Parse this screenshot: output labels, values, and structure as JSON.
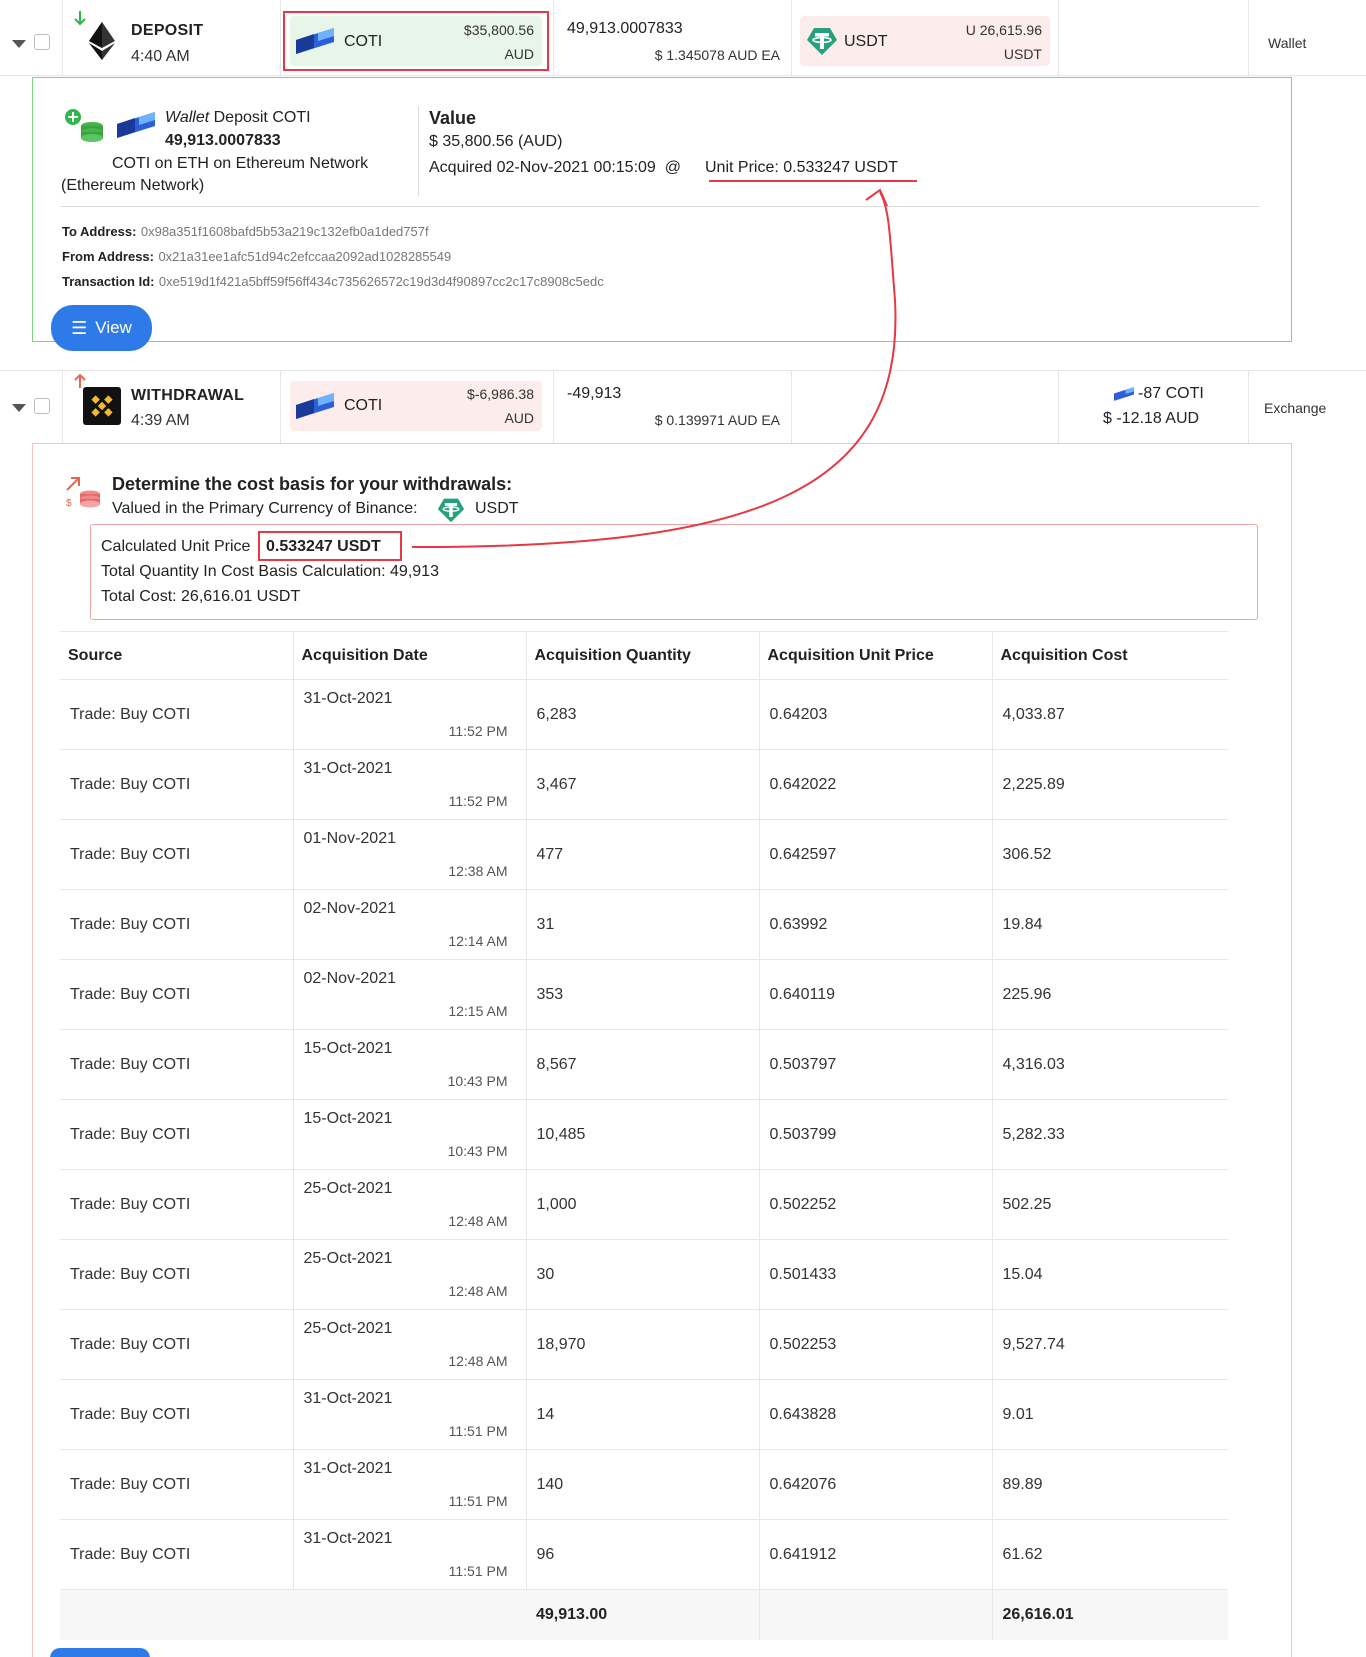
{
  "deposit_row": {
    "type": "DEPOSIT",
    "time": "4:40 AM",
    "sent_asset": {
      "name": "COTI",
      "amount": "$35,800.56",
      "currency": "AUD"
    },
    "quantity": "49,913.0007833",
    "unit_value": "$ 1.345078 AUD EA",
    "fee_asset": {
      "name": "USDT",
      "amount": "U 26,615.96",
      "currency": "USDT"
    },
    "account_type": "Wallet"
  },
  "deposit_detail": {
    "label_italic": "Wallet",
    "label_rest": " Deposit COTI",
    "quantity": "49,913.0007833",
    "network_line1": "COTI on ETH on Ethereum Network",
    "network_line2": "(Ethereum Network)",
    "value_heading": "Value",
    "value_amount": "$ 35,800.56 (AUD)",
    "acquired_text": "Acquired 02-Nov-2021 00:15:09  @",
    "unit_price_text": "Unit Price: 0.533247 USDT",
    "to_label": "To Address:",
    "to_value": "0x98a351f1608bafd5b53a219c132efb0a1ded757f",
    "from_label": "From Address:",
    "from_value": "0x21a31ee1afc51d94c2efccaa2092ad1028285549",
    "tx_label": "Transaction Id:",
    "tx_value": "0xe519d1f421a5bff59f56ff434c735626572c19d3d4f90897cc2c17c8908c5edc",
    "view_button": "View"
  },
  "withdrawal_row": {
    "type": "WITHDRAWAL",
    "time": "4:39 AM",
    "sent_asset": {
      "name": "COTI",
      "amount": "$-6,986.38",
      "currency": "AUD"
    },
    "quantity": "-49,913",
    "unit_value": "$ 0.139971 AUD EA",
    "fee_qty": "-87 COTI",
    "fee_value": "$ -12.18 AUD",
    "account_type": "Exchange"
  },
  "cost_basis": {
    "heading": "Determine the cost basis for your withdrawals:",
    "valued_in": "Valued in the Primary Currency of Binance:",
    "primary_currency": "USDT",
    "calc_label": "Calculated Unit Price",
    "calc_value": "0.533247 USDT",
    "total_qty": "Total Quantity In Cost Basis Calculation: 49,913",
    "total_cost": "Total Cost: 26,616.01 USDT"
  },
  "table": {
    "headers": [
      "Source",
      "Acquisition Date",
      "Acquisition Quantity",
      "Acquisition Unit Price",
      "Acquisition Cost"
    ],
    "rows": [
      {
        "source": "Trade: Buy COTI",
        "date": "31-Oct-2021",
        "time": "11:52 PM",
        "qty": "6,283",
        "price": "0.64203",
        "cost": "4,033.87"
      },
      {
        "source": "Trade: Buy COTI",
        "date": "31-Oct-2021",
        "time": "11:52 PM",
        "qty": "3,467",
        "price": "0.642022",
        "cost": "2,225.89"
      },
      {
        "source": "Trade: Buy COTI",
        "date": "01-Nov-2021",
        "time": "12:38 AM",
        "qty": "477",
        "price": "0.642597",
        "cost": "306.52"
      },
      {
        "source": "Trade: Buy COTI",
        "date": "02-Nov-2021",
        "time": "12:14 AM",
        "qty": "31",
        "price": "0.63992",
        "cost": "19.84"
      },
      {
        "source": "Trade: Buy COTI",
        "date": "02-Nov-2021",
        "time": "12:15 AM",
        "qty": "353",
        "price": "0.640119",
        "cost": "225.96"
      },
      {
        "source": "Trade: Buy COTI",
        "date": "15-Oct-2021",
        "time": "10:43 PM",
        "qty": "8,567",
        "price": "0.503797",
        "cost": "4,316.03"
      },
      {
        "source": "Trade: Buy COTI",
        "date": "15-Oct-2021",
        "time": "10:43 PM",
        "qty": "10,485",
        "price": "0.503799",
        "cost": "5,282.33"
      },
      {
        "source": "Trade: Buy COTI",
        "date": "25-Oct-2021",
        "time": "12:48 AM",
        "qty": "1,000",
        "price": "0.502252",
        "cost": "502.25"
      },
      {
        "source": "Trade: Buy COTI",
        "date": "25-Oct-2021",
        "time": "12:48 AM",
        "qty": "30",
        "price": "0.501433",
        "cost": "15.04"
      },
      {
        "source": "Trade: Buy COTI",
        "date": "25-Oct-2021",
        "time": "12:48 AM",
        "qty": "18,970",
        "price": "0.502253",
        "cost": "9,527.74"
      },
      {
        "source": "Trade: Buy COTI",
        "date": "31-Oct-2021",
        "time": "11:51 PM",
        "qty": "14",
        "price": "0.643828",
        "cost": "9.01"
      },
      {
        "source": "Trade: Buy COTI",
        "date": "31-Oct-2021",
        "time": "11:51 PM",
        "qty": "140",
        "price": "0.642076",
        "cost": "89.89"
      },
      {
        "source": "Trade: Buy COTI",
        "date": "31-Oct-2021",
        "time": "11:51 PM",
        "qty": "96",
        "price": "0.641912",
        "cost": "61.62"
      }
    ],
    "total_qty": "49,913.00",
    "total_cost": "26,616.01"
  },
  "colors": {
    "annotation_red": "#e53945",
    "deposit_green": "#7ed37e",
    "tether_green": "#26a17b",
    "binance_yellow": "#f3ba2f",
    "button_blue": "#2e7ae8"
  },
  "icons": {
    "deposit_arrow": "arrow-down-icon",
    "withdrawal_arrow": "arrow-up-icon",
    "ethereum": "ethereum-icon",
    "binance": "binance-icon",
    "coti": "coti-icon",
    "tether": "tether-icon",
    "view": "list-icon"
  }
}
